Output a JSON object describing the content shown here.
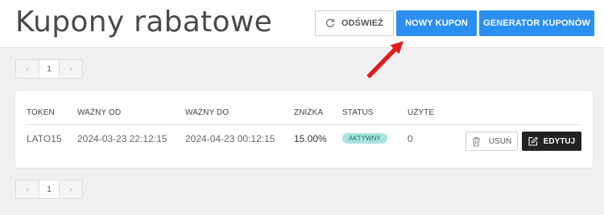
{
  "header": {
    "title": "Kupony rabatowe",
    "refresh_label": "ODŚWIEŻ",
    "new_coupon_label": "NOWY KUPON",
    "generator_label": "GENERATOR KUPONÓW"
  },
  "pagination": {
    "prev": "‹",
    "next": "›",
    "current_page": "1"
  },
  "table": {
    "columns": [
      "TOKEN",
      "WAŻNY OD",
      "WAŻNY DO",
      "ZNIŻKA",
      "STATUS",
      "UŻYTE"
    ],
    "rows": [
      {
        "token": "LATO15",
        "valid_from": "2024-03-23 22:12:15",
        "valid_to": "2024-04-23 00:12:15",
        "discount": "15.00%",
        "status": "AKTYWNY",
        "used": "0",
        "delete_label": "USUŃ",
        "edit_label": "EDYTUJ"
      }
    ]
  },
  "icons": {
    "refresh": "refresh-icon",
    "trash": "trash-icon",
    "edit": "edit-icon",
    "annotation": "red-arrow"
  },
  "colors": {
    "primary": "#2a8ff0",
    "dark_button": "#222222",
    "badge_bg": "#a8e2df",
    "annotation_arrow": "#e41b1b"
  }
}
